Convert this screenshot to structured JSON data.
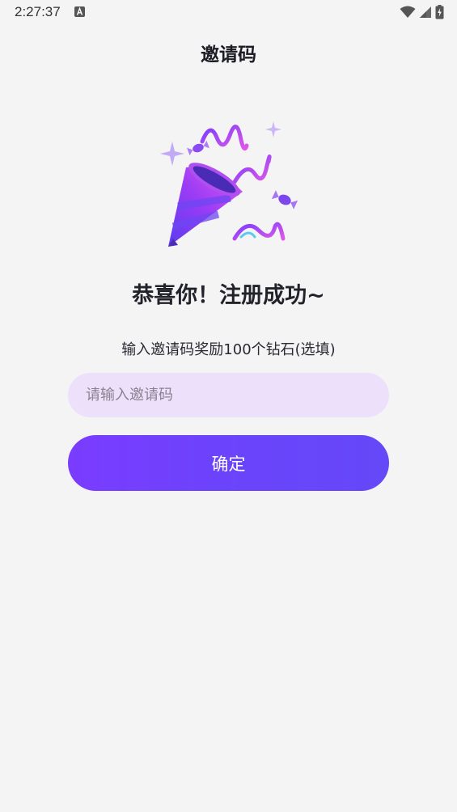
{
  "status_bar": {
    "time": "2:27:37"
  },
  "header": {
    "title": "邀请码"
  },
  "main": {
    "success_title": "恭喜你！注册成功~",
    "reward_text": "输入邀请码奖励100个钻石(选填)",
    "invite_input": {
      "value": "",
      "placeholder": "请输入邀请码"
    },
    "confirm_label": "确定"
  },
  "icons": {
    "status_notification": "a-icon",
    "status_wifi": "wifi-icon",
    "status_signal": "signal-icon",
    "status_battery": "battery-charging-icon",
    "illustration": "party-popper-icon"
  },
  "colors": {
    "background": "#f4f4f5",
    "input_background": "#ede0fb",
    "button_gradient_start": "#7a3cff",
    "button_gradient_end": "#6548f8"
  }
}
